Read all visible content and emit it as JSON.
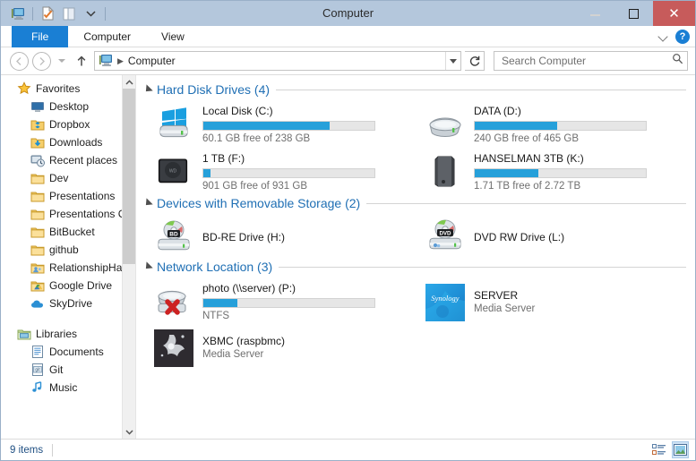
{
  "window": {
    "title": "Computer",
    "quick_access": [
      "computer-icon",
      "properties-icon",
      "panel-icon",
      "customize-dropdown"
    ],
    "controls": {
      "minimize": "–",
      "maximize": "□",
      "close": "✕"
    }
  },
  "ribbon": {
    "tabs": [
      {
        "label": "File",
        "active_file": true
      },
      {
        "label": "Computer",
        "active_file": false
      },
      {
        "label": "View",
        "active_file": false
      }
    ],
    "collapse_icon": "chevron-down-icon",
    "help_label": "?"
  },
  "address": {
    "back": "←",
    "forward": "→",
    "recent_dropdown": "dropdown-arrow",
    "up": "↑",
    "crumb_icon": "computer-icon",
    "crumb_sep": "▶",
    "crumb_text": "Computer",
    "refresh": "⟳",
    "search_placeholder": "Search Computer",
    "search_value": "",
    "search_icon": "search-icon"
  },
  "sidebar": {
    "items": [
      {
        "label": "Favorites",
        "level": "root",
        "icon": "star-icon"
      },
      {
        "label": "Desktop",
        "level": "child",
        "icon": "desktop-icon"
      },
      {
        "label": "Dropbox",
        "level": "child",
        "icon": "dropbox-folder-icon"
      },
      {
        "label": "Downloads",
        "level": "child",
        "icon": "downloads-folder-icon"
      },
      {
        "label": "Recent places",
        "level": "child",
        "icon": "recent-places-icon"
      },
      {
        "label": "Dev",
        "level": "child",
        "icon": "folder-icon"
      },
      {
        "label": "Presentations",
        "level": "child",
        "icon": "folder-icon"
      },
      {
        "label": "Presentations CU",
        "level": "child",
        "icon": "folder-icon"
      },
      {
        "label": "BitBucket",
        "level": "child",
        "icon": "folder-icon"
      },
      {
        "label": "github",
        "level": "child",
        "icon": "folder-icon"
      },
      {
        "label": "RelationshipHack",
        "level": "child",
        "icon": "shared-folder-icon"
      },
      {
        "label": "Google Drive",
        "level": "child",
        "icon": "google-drive-folder-icon"
      },
      {
        "label": "SkyDrive",
        "level": "child",
        "icon": "skydrive-cloud-icon"
      },
      {
        "label": "Libraries",
        "level": "root",
        "icon": "libraries-icon",
        "gap": true
      },
      {
        "label": "Documents",
        "level": "child",
        "icon": "documents-library-icon"
      },
      {
        "label": "Git",
        "level": "child",
        "icon": "git-library-icon"
      },
      {
        "label": "Music",
        "level": "child",
        "icon": "music-library-icon"
      }
    ],
    "scroll_up_icon": "chevron-up-icon",
    "scroll_down_icon": "chevron-down-icon"
  },
  "groups": [
    {
      "title": "Hard Disk Drives (4)",
      "items": [
        {
          "name": "Local Disk (C:)",
          "sub": "60.1 GB free of 238 GB",
          "bar": true,
          "fill_pct": 74,
          "icon": "windows-drive-icon"
        },
        {
          "name": "DATA (D:)",
          "sub": "240 GB free of 465 GB",
          "bar": true,
          "fill_pct": 48,
          "icon": "hard-drive-icon"
        },
        {
          "name": "1 TB (F:)",
          "sub": "901 GB free of 931 GB",
          "bar": true,
          "fill_pct": 4,
          "icon": "external-drive-icon"
        },
        {
          "name": "HANSELMAN 3TB (K:)",
          "sub": "1.71 TB free of 2.72 TB",
          "bar": true,
          "fill_pct": 37,
          "icon": "external-drive-tall-icon"
        }
      ]
    },
    {
      "title": "Devices with Removable Storage (2)",
      "items": [
        {
          "name": "BD-RE Drive (H:)",
          "sub": "",
          "bar": false,
          "icon": "bd-re-drive-icon"
        },
        {
          "name": "DVD RW Drive (L:)",
          "sub": "",
          "bar": false,
          "icon": "dvd-rw-drive-icon"
        }
      ]
    },
    {
      "title": "Network Location (3)",
      "items": [
        {
          "name": "photo (\\\\server) (P:)",
          "sub": "NTFS",
          "bar": true,
          "fill_pct": 20,
          "icon": "disconnected-network-drive-icon"
        },
        {
          "name": "SERVER",
          "sub": "Media Server",
          "bar": false,
          "icon": "synology-logo-icon"
        },
        {
          "name": "XBMC (raspbmc)",
          "sub": "Media Server",
          "bar": false,
          "icon": "xbmc-logo-icon"
        }
      ]
    }
  ],
  "status": {
    "item_count": "9 items",
    "view_details_icon": "details-view-icon",
    "view_large_icons_icon": "large-icons-view-icon"
  }
}
